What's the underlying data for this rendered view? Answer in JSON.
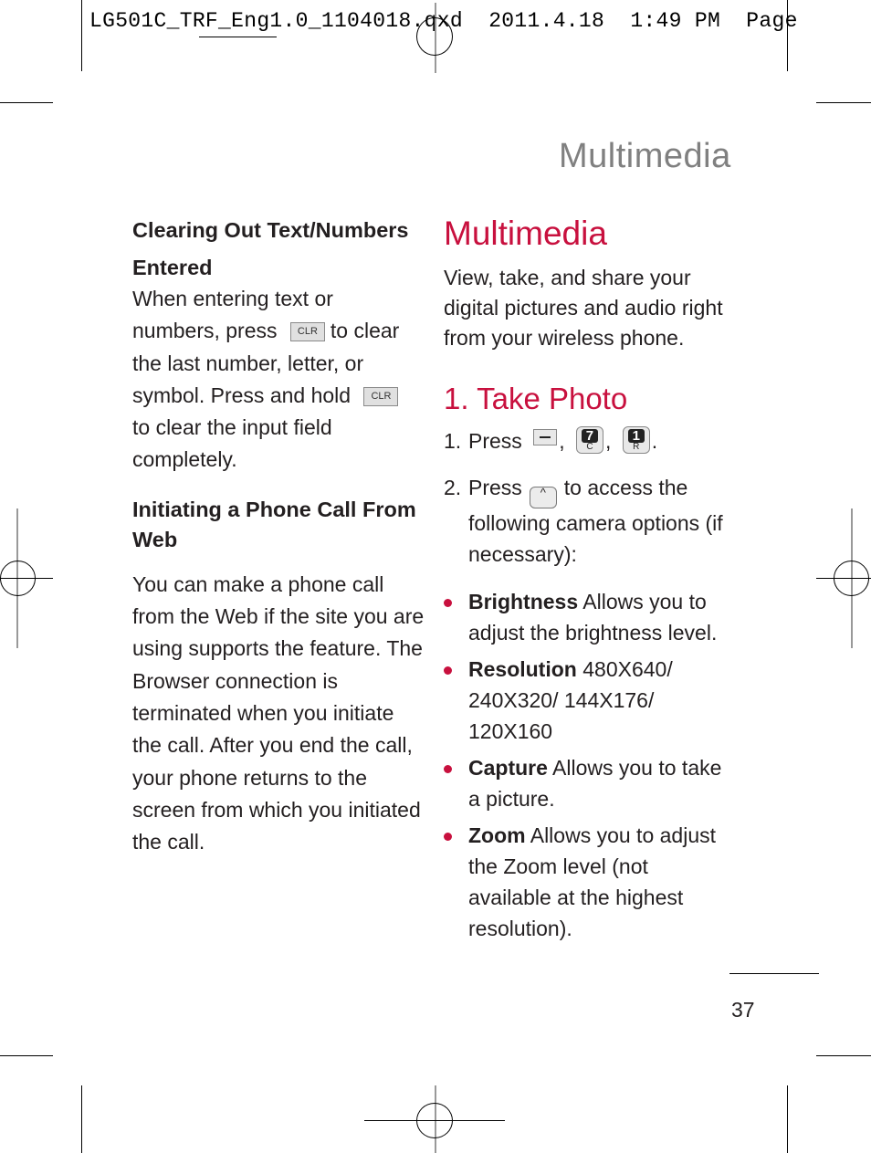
{
  "slug": {
    "filename": "LG501C_TRF_Eng1.0_1104018.qxd",
    "date": "2011.4.18",
    "time": "1:49 PM",
    "page_label": "Page"
  },
  "running_head": "Multimedia",
  "left_column": {
    "section1": {
      "heading": "Clearing Out Text/Numbers Entered",
      "text_parts": [
        "When entering text or numbers, press",
        "to clear the last number, letter, or symbol. Press and hold",
        "to clear the input field completely."
      ],
      "key_label": "CLR"
    },
    "section2": {
      "heading": "Initiating a Phone Call From Web",
      "text": "You can make a phone call from the Web if the site you are using supports the feature. The Browser connection is terminated when you initiate the call. After you end the call, your phone returns to the screen from which you initiated the call."
    }
  },
  "right_column": {
    "title": "Multimedia",
    "intro": "View, take, and share your digital pictures and audio right from your wireless phone.",
    "subsection_title": "1. Take Photo",
    "steps": [
      {
        "num": "1.",
        "prefix": "Press",
        "keys": [
          {
            "icon": "menu-key-icon"
          },
          {
            "icon": "key-7-icon",
            "top": "7",
            "bottom": "C"
          },
          {
            "icon": "key-1-icon",
            "top": "1",
            "bottom": "R"
          }
        ]
      },
      {
        "num": "2.",
        "prefix": "Press",
        "key_glyph": "^",
        "suffix": "to access the following camera options (if necessary):"
      }
    ],
    "bullets": [
      {
        "term": "Brightness",
        "desc": "Allows you to adjust the brightness level."
      },
      {
        "term": "Resolution",
        "desc": "480X640/ 240X320/ 144X176/ 120X160"
      },
      {
        "term": "Capture",
        "desc": "Allows you to take a picture."
      },
      {
        "term": "Zoom",
        "desc": "Allows you to adjust the Zoom level (not available at the highest resolution)."
      }
    ]
  },
  "page_number": "37",
  "colors": {
    "accent": "#c8103e",
    "running_head": "#808080",
    "text": "#231f20"
  }
}
